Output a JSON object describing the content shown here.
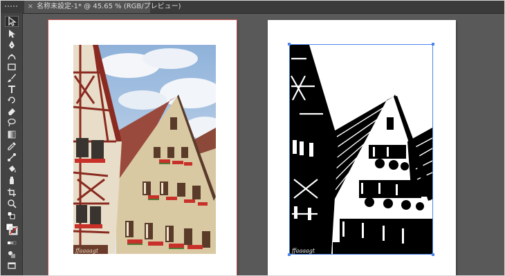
{
  "document": {
    "tab_title": "名称未設定-1* @ 45.65 % (RGB/プレビュー)",
    "close_glyph": "×"
  },
  "tools": [
    {
      "name": "selection-tool"
    },
    {
      "name": "direct-selection-tool"
    },
    {
      "name": "pen-tool"
    },
    {
      "name": "curvature-tool"
    },
    {
      "name": "rectangle-tool"
    },
    {
      "name": "paintbrush-tool"
    },
    {
      "name": "type-tool"
    },
    {
      "name": "rotate-tool"
    },
    {
      "name": "eraser-tool"
    },
    {
      "name": "lasso-tool"
    },
    {
      "name": "gradient-tool"
    },
    {
      "name": "eyedropper-tool"
    },
    {
      "name": "blend-tool"
    },
    {
      "name": "live-paint-bucket-tool"
    },
    {
      "name": "symbol-sprayer-tool"
    },
    {
      "name": "artboard-tool"
    },
    {
      "name": "zoom-tool"
    }
  ],
  "swatches": {
    "fill_color": "#ffffff",
    "stroke_color": "#e0201c"
  },
  "colors": {
    "bleed_guide": "#c3504f",
    "selection": "#4a86e8",
    "canvas": "#595959"
  },
  "image_text": {
    "sign_left": "ffaaaagt",
    "sign_right": "ffaaaagt"
  }
}
